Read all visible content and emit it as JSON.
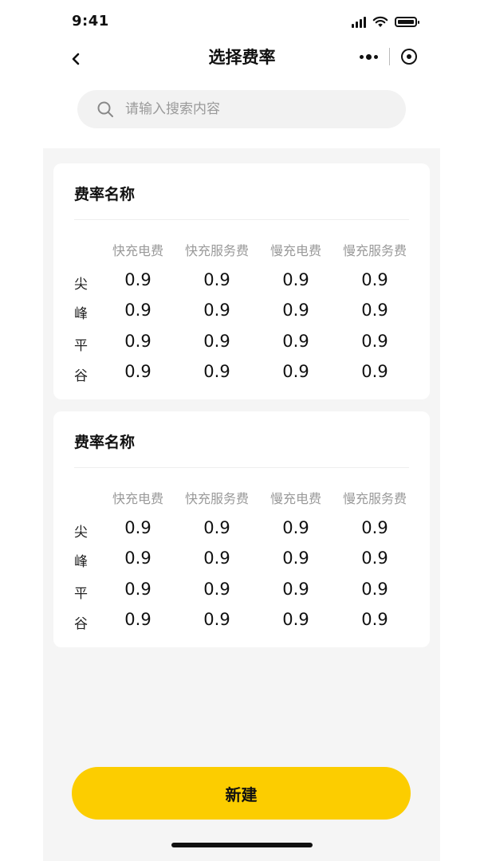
{
  "status_bar": {
    "time": "9:41"
  },
  "nav": {
    "title": "选择费率"
  },
  "search": {
    "placeholder": "请输入搜索内容"
  },
  "cards": [
    {
      "title": "费率名称",
      "columns": [
        "快充电费",
        "快充服务费",
        "慢充电费",
        "慢充服务费"
      ],
      "rows": [
        {
          "label": "尖",
          "values": [
            "0.9",
            "0.9",
            "0.9",
            "0.9"
          ]
        },
        {
          "label": "峰",
          "values": [
            "0.9",
            "0.9",
            "0.9",
            "0.9"
          ]
        },
        {
          "label": "平",
          "values": [
            "0.9",
            "0.9",
            "0.9",
            "0.9"
          ]
        },
        {
          "label": "谷",
          "values": [
            "0.9",
            "0.9",
            "0.9",
            "0.9"
          ]
        }
      ]
    },
    {
      "title": "费率名称",
      "columns": [
        "快充电费",
        "快充服务费",
        "慢充电费",
        "慢充服务费"
      ],
      "rows": [
        {
          "label": "尖",
          "values": [
            "0.9",
            "0.9",
            "0.9",
            "0.9"
          ]
        },
        {
          "label": "峰",
          "values": [
            "0.9",
            "0.9",
            "0.9",
            "0.9"
          ]
        },
        {
          "label": "平",
          "values": [
            "0.9",
            "0.9",
            "0.9",
            "0.9"
          ]
        },
        {
          "label": "谷",
          "values": [
            "0.9",
            "0.9",
            "0.9",
            "0.9"
          ]
        }
      ]
    }
  ],
  "footer": {
    "new_label": "新建"
  },
  "colors": {
    "accent": "#fccd00",
    "page_bg": "#f5f5f5"
  }
}
